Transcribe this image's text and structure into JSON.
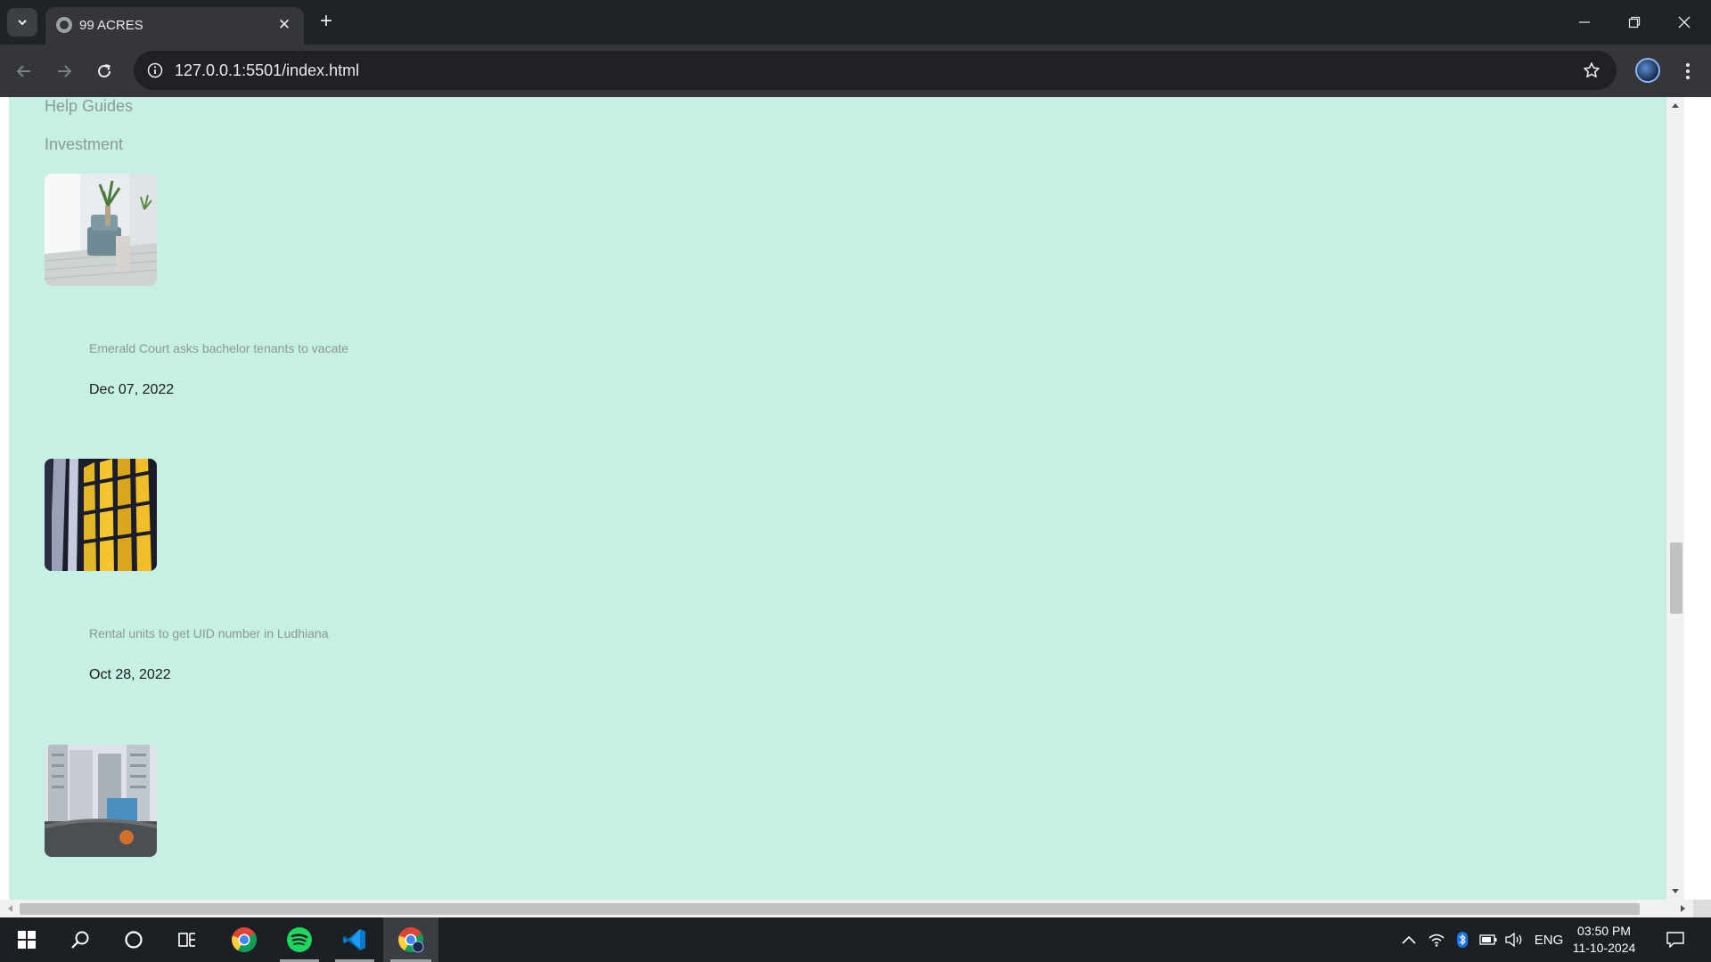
{
  "browser": {
    "tab": {
      "title": "99 ACRES",
      "close": "✕"
    },
    "new_tab": "+",
    "url": "127.0.0.1:5501/index.html"
  },
  "page": {
    "nav_links": [
      "Help Guides",
      "Investment"
    ],
    "articles": [
      {
        "title": "Emerald Court asks bachelor tenants to vacate",
        "date": "Dec 07, 2022",
        "image": "interior-room-image"
      },
      {
        "title": "Rental units to get UID number in Ludhiana",
        "date": "Oct 28, 2022",
        "image": "building-facade-image"
      },
      {
        "title": "",
        "date": "",
        "image": "highrise-towers-image"
      }
    ],
    "background": "#c6f0e4"
  },
  "taskbar": {
    "apps": [
      "start-icon",
      "search-icon",
      "cortana-icon",
      "task-view-icon",
      "chrome-icon",
      "spotify-icon",
      "vscode-icon",
      "chrome-profile-icon"
    ],
    "language": "ENG",
    "time": "03:50 PM",
    "date": "11-10-2024"
  }
}
